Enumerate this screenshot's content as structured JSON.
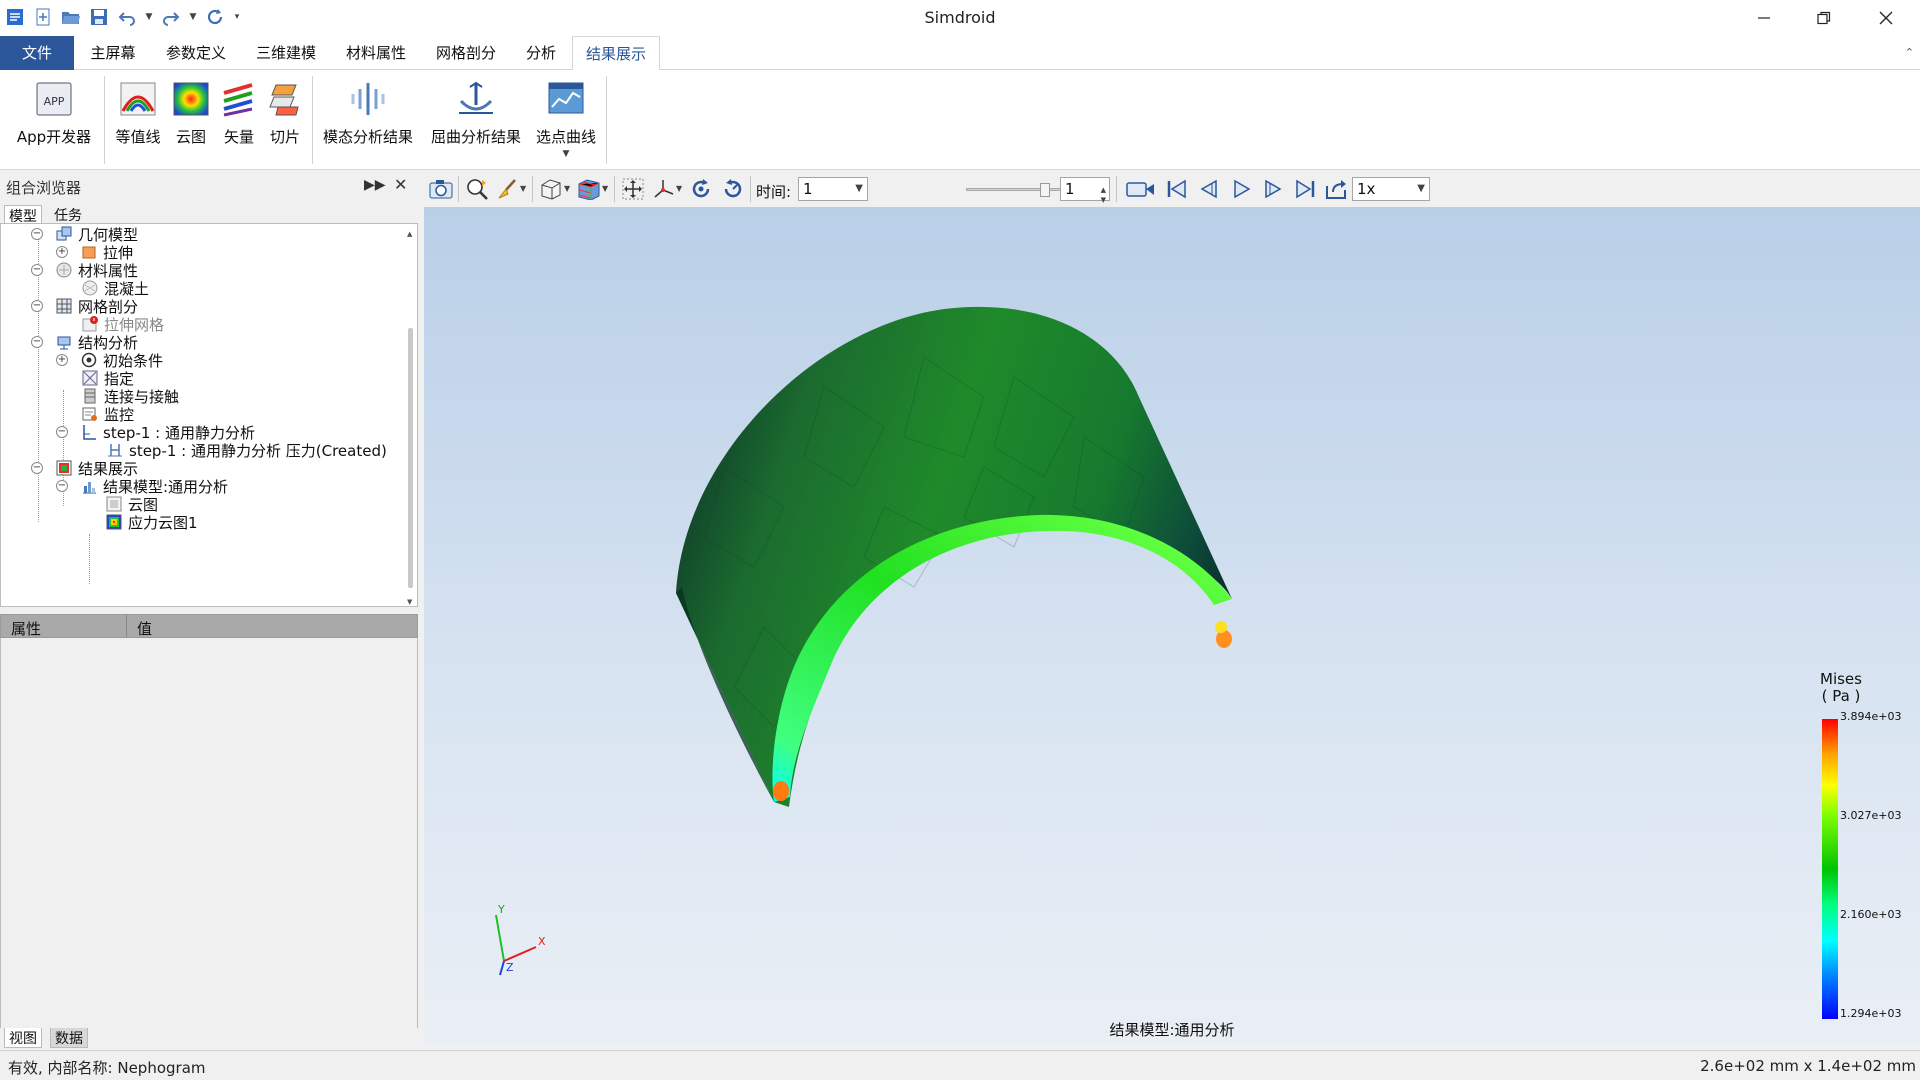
{
  "app": {
    "title": "Simdroid"
  },
  "ribbon_tabs": [
    {
      "label": "文件"
    },
    {
      "label": "主屏幕"
    },
    {
      "label": "参数定义"
    },
    {
      "label": "三维建模"
    },
    {
      "label": "材料属性"
    },
    {
      "label": "网格剖分"
    },
    {
      "label": "分析"
    },
    {
      "label": "结果展示"
    }
  ],
  "active_tab": "结果展示",
  "ribbon_buttons": [
    {
      "label": "App开发器",
      "icon": "app-developer-icon"
    },
    {
      "label": "等值线",
      "icon": "contour-lines-icon"
    },
    {
      "label": "云图",
      "icon": "cloud-map-icon"
    },
    {
      "label": "矢量",
      "icon": "vector-icon"
    },
    {
      "label": "切片",
      "icon": "slice-icon"
    },
    {
      "label": "模态分析结果",
      "icon": "modal-analysis-icon"
    },
    {
      "label": "屈曲分析结果",
      "icon": "buckling-analysis-icon"
    },
    {
      "label": "选点曲线",
      "icon": "point-curve-icon"
    }
  ],
  "browser": {
    "title": "组合浏览器",
    "tabs": [
      "模型",
      "任务"
    ],
    "active_tab": "模型",
    "tree": [
      {
        "label": "几何模型",
        "icon": "geometry-icon"
      },
      {
        "label": "拉伸",
        "icon": "extrude-icon"
      },
      {
        "label": "材料属性",
        "icon": "material-icon"
      },
      {
        "label": "混凝土",
        "icon": "concrete-icon"
      },
      {
        "label": "网格剖分",
        "icon": "mesh-icon"
      },
      {
        "label": "拉伸网格",
        "icon": "mesh-warning-icon"
      },
      {
        "label": "结构分析",
        "icon": "structural-analysis-icon"
      },
      {
        "label": "初始条件",
        "icon": "initial-condition-icon"
      },
      {
        "label": "指定",
        "icon": "assign-icon"
      },
      {
        "label": "连接与接触",
        "icon": "connection-icon"
      },
      {
        "label": "监控",
        "icon": "monitor-icon"
      },
      {
        "label": "step-1 : 通用静力分析",
        "icon": "step-icon"
      },
      {
        "label": "step-1 : 通用静力分析 压力(Created)",
        "icon": "pressure-icon"
      },
      {
        "label": "结果展示",
        "icon": "results-icon"
      },
      {
        "label": "结果模型:通用分析",
        "icon": "result-model-icon"
      },
      {
        "label": "云图",
        "icon": "cloud-item-icon"
      },
      {
        "label": "应力云图1",
        "icon": "stress-cloud-icon"
      }
    ]
  },
  "properties": {
    "col_property": "属性",
    "col_value": "值"
  },
  "bottom_tabs": [
    "视图",
    "数据"
  ],
  "view_toolbar": {
    "time_label": "时间:",
    "time_value": "1",
    "frame_value": "1",
    "speed_value": "1x"
  },
  "viewport": {
    "caption": "结果模型:通用分析",
    "legend": {
      "title_line1": "Mises",
      "title_line2": "( Pa )",
      "ticks": [
        "3.894e+03",
        "3.027e+03",
        "2.160e+03",
        "1.294e+03"
      ],
      "colors": {
        "high": "#ff0000",
        "mid": "#00c400",
        "low": "#0000ff"
      }
    },
    "triad": {
      "x": "X",
      "y": "Y",
      "z": "Z"
    }
  },
  "status": {
    "left": "有效, 内部名称: Nephogram",
    "right": "2.6e+02 mm x 1.4e+02 mm"
  }
}
